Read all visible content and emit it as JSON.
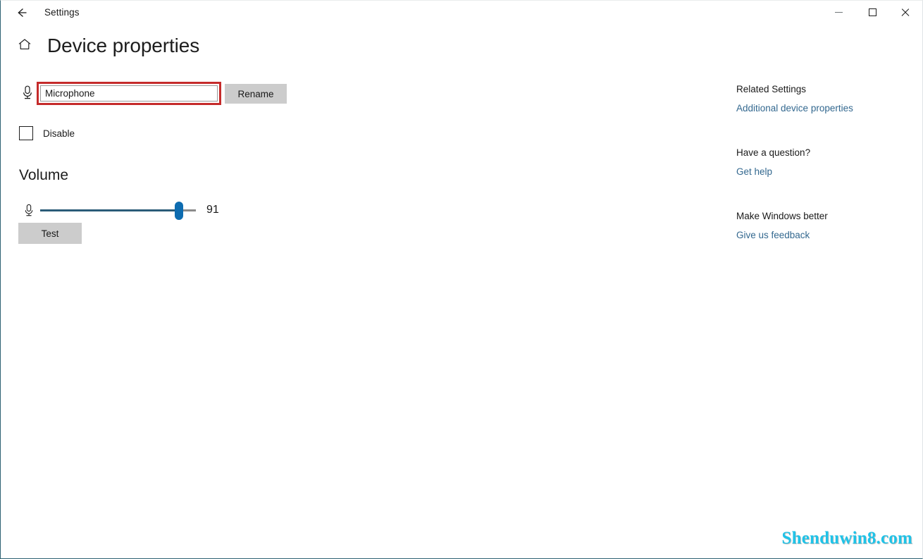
{
  "window": {
    "title": "Settings",
    "back_icon": "back-arrow-icon",
    "minimize_icon": "minimize-icon",
    "maximize_icon": "maximize-icon",
    "close_icon": "close-icon"
  },
  "page": {
    "home_icon": "home-icon",
    "title": "Device properties"
  },
  "device_name": {
    "icon": "microphone-icon",
    "value": "Microphone",
    "placeholder": "Microphone",
    "rename_label": "Rename",
    "highlight_color": "#c52b2b"
  },
  "disable": {
    "label": "Disable",
    "checked": false
  },
  "volume": {
    "heading": "Volume",
    "icon": "microphone-icon",
    "value": "91",
    "min": 0,
    "max": 100,
    "test_label": "Test",
    "fill_color": "#2b5c78",
    "thumb_color": "#0d6cb0",
    "rest_color": "#8b8b8b"
  },
  "sidebar": {
    "groups": [
      {
        "heading": "Related Settings",
        "links": [
          "Additional device properties"
        ]
      },
      {
        "heading": "Have a question?",
        "links": [
          "Get help"
        ]
      },
      {
        "heading": "Make Windows better",
        "links": [
          "Give us feedback"
        ]
      }
    ],
    "link_color": "#33688f"
  },
  "watermark": {
    "text": "Shenduwin8.com",
    "color": "#1fc3e8"
  }
}
